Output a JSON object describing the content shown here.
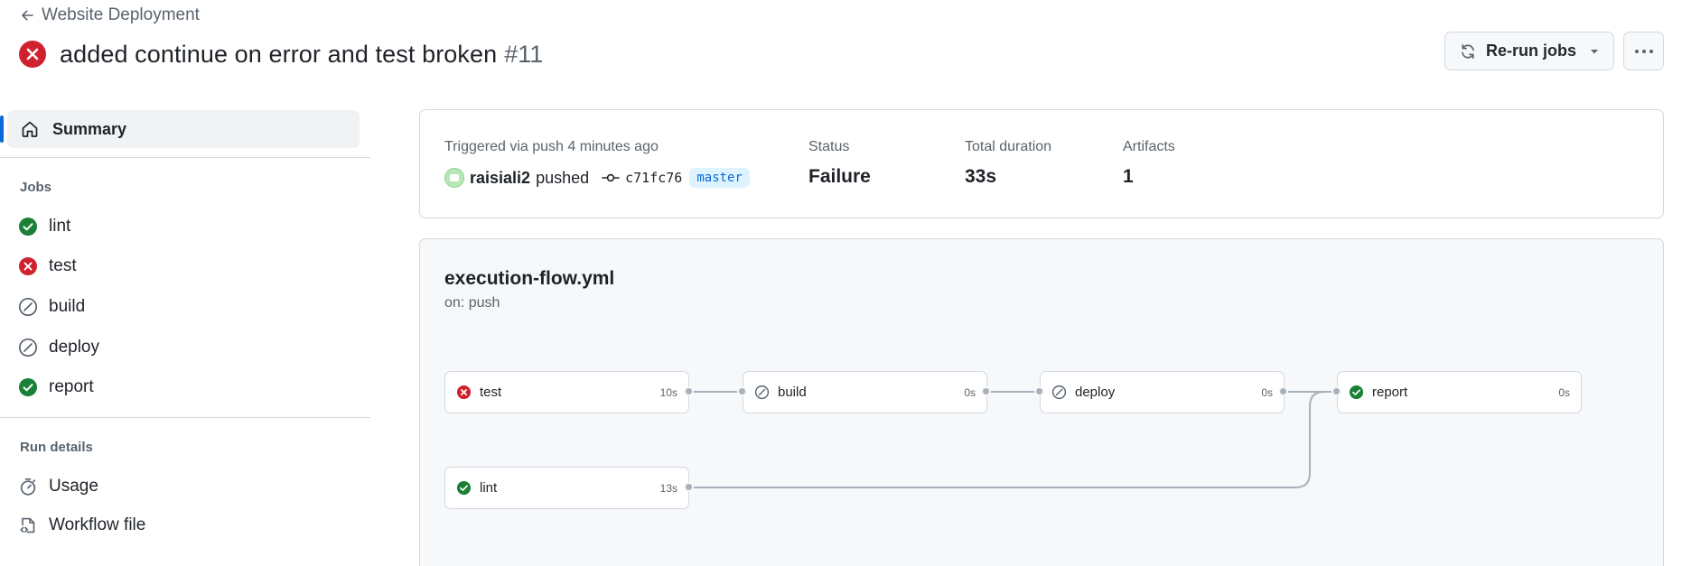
{
  "header": {
    "back_label": "Website Deployment",
    "run_title": "added continue on error and test broken",
    "run_number": "#11",
    "rerun_label": "Re-run jobs",
    "more_icon": "kebab-horizontal-icon"
  },
  "sidebar": {
    "summary_label": "Summary",
    "jobs_heading": "Jobs",
    "jobs": [
      {
        "label": "lint",
        "status": "success"
      },
      {
        "label": "test",
        "status": "failure"
      },
      {
        "label": "build",
        "status": "skipped"
      },
      {
        "label": "deploy",
        "status": "skipped"
      },
      {
        "label": "report",
        "status": "success"
      }
    ],
    "run_details_heading": "Run details",
    "details": [
      {
        "label": "Usage",
        "icon": "stopwatch-icon"
      },
      {
        "label": "Workflow file",
        "icon": "file-code-icon"
      }
    ]
  },
  "summary": {
    "trigger_text": "Triggered via push 4 minutes ago",
    "actor": "raisiali2",
    "action": "pushed",
    "commit": "c71fc76",
    "branch": "master",
    "status_label": "Status",
    "status_value": "Failure",
    "duration_label": "Total duration",
    "duration_value": "33s",
    "artifacts_label": "Artifacts",
    "artifacts_value": "1"
  },
  "workflow": {
    "file_name": "execution-flow.yml",
    "trigger": "on: push",
    "nodes": [
      {
        "name": "test",
        "duration": "10s",
        "status": "failure"
      },
      {
        "name": "build",
        "duration": "0s",
        "status": "skipped"
      },
      {
        "name": "deploy",
        "duration": "0s",
        "status": "skipped"
      },
      {
        "name": "report",
        "duration": "0s",
        "status": "success"
      },
      {
        "name": "lint",
        "duration": "13s",
        "status": "success"
      }
    ]
  },
  "colors": {
    "failure": "#cf222e",
    "success": "#1a7f37",
    "skipped": "#59636e",
    "accent": "#0969da"
  }
}
